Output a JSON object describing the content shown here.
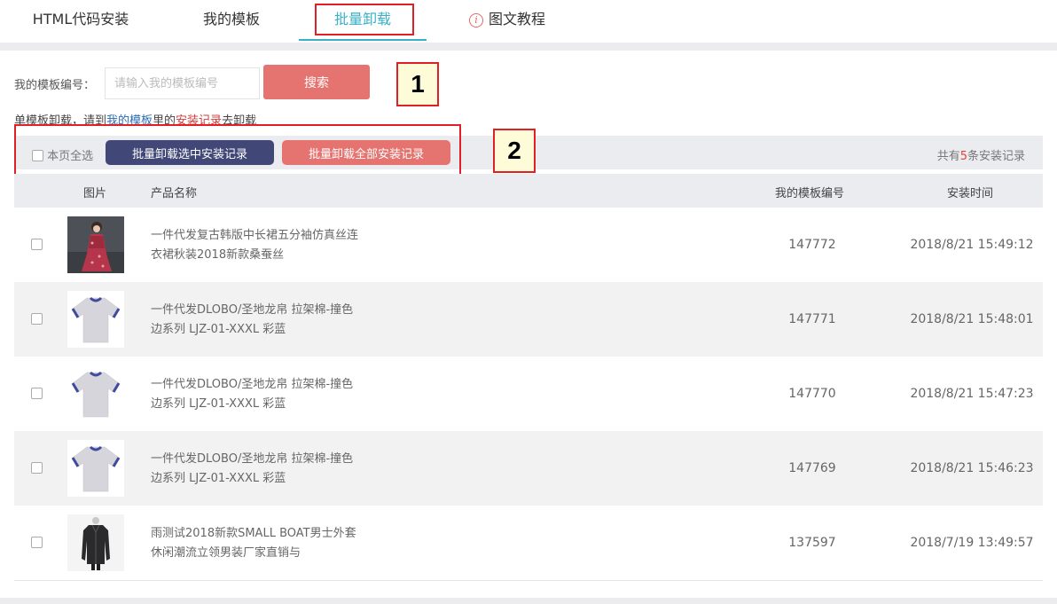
{
  "tabs": [
    {
      "label": "HTML代码安装"
    },
    {
      "label": "我的模板"
    },
    {
      "label": "批量卸载"
    },
    {
      "label": "图文教程"
    }
  ],
  "search": {
    "label": "我的模板编号：",
    "placeholder": "请输入我的模板编号",
    "button": "搜索"
  },
  "hint": {
    "pre": "单模板卸载，请到",
    "link1": "我的模板",
    "mid": "里的",
    "link2": "安装记录",
    "post": "去卸载"
  },
  "callouts": [
    "1",
    "2"
  ],
  "batch": {
    "select_all": "本页全选",
    "btn_selected": "批量卸载选中安装记录",
    "btn_all": "批量卸载全部安装记录",
    "total_pre": "共有",
    "total_num": "5",
    "total_post": "条安装记录"
  },
  "table": {
    "headers": [
      "图片",
      "产品名称",
      "我的模板编号",
      "安装时间"
    ],
    "rows": [
      {
        "name1": "一件代发复古韩版中长裙五分袖仿真丝连",
        "name2": "衣裙秋装2018新款桑蚕丝",
        "id": "147772",
        "time": "2018/8/21 15:49:12",
        "image": "dress-photo"
      },
      {
        "name1": "一件代发DLOBO/圣地龙帛 拉架棉-撞色",
        "name2": "边系列 LJZ-01-XXXL 彩蓝",
        "id": "147771",
        "time": "2018/8/21 15:48:01",
        "image": "tshirt-photo"
      },
      {
        "name1": "一件代发DLOBO/圣地龙帛 拉架棉-撞色",
        "name2": "边系列 LJZ-01-XXXL 彩蓝",
        "id": "147770",
        "time": "2018/8/21 15:47:23",
        "image": "tshirt-photo"
      },
      {
        "name1": "一件代发DLOBO/圣地龙帛 拉架棉-撞色",
        "name2": "边系列 LJZ-01-XXXL 彩蓝",
        "id": "147769",
        "time": "2018/8/21 15:46:23",
        "image": "tshirt-photo"
      },
      {
        "name1": "雨测试2018新款SMALL BOAT男士外套",
        "name2": "休闲潮流立领男装厂家直销与",
        "id": "137597",
        "time": "2018/7/19 13:49:57",
        "image": "jacket-photo"
      }
    ]
  },
  "colors": {
    "accent": "#3ab0c7",
    "primary_btn": "#e57370",
    "dark_btn": "#414776",
    "highlight_box": "#e01f26"
  }
}
